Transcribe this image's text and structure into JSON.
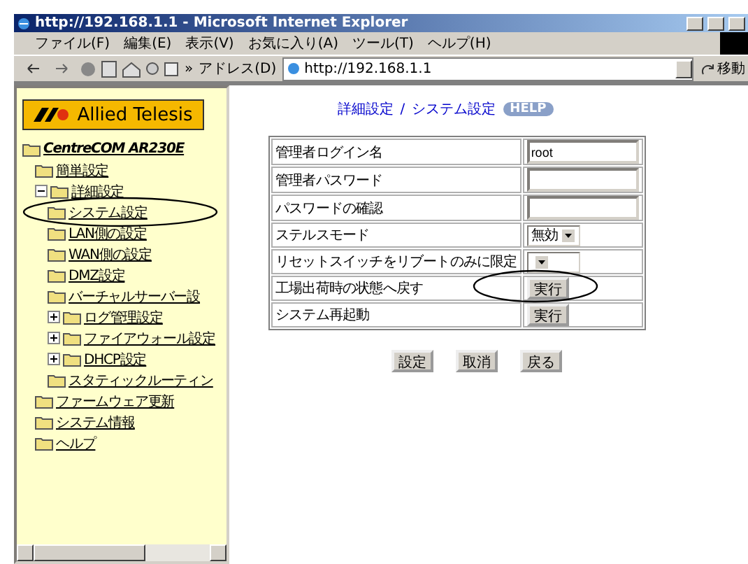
{
  "window": {
    "title": "http://192.168.1.1 - Microsoft Internet Explorer"
  },
  "menu": [
    "ファイル(F)",
    "編集(E)",
    "表示(V)",
    "お気に入り(A)",
    "ツール(T)",
    "ヘルプ(H)"
  ],
  "toolbar": {
    "chevron": "»",
    "address_label": "アドレス(D)",
    "address": "http://192.168.1.1",
    "go": "移動"
  },
  "sidebar": {
    "logo": "Allied Telesis",
    "tree": [
      {
        "label": "CentreCOM AR230E",
        "children": [
          {
            "label": "簡単設定"
          },
          {
            "label": "詳細設定",
            "expanded": true,
            "children": [
              {
                "label": "システム設定"
              },
              {
                "label": "LAN側の設定"
              },
              {
                "label": "WAN側の設定"
              },
              {
                "label": "DMZ設定"
              },
              {
                "label": "バーチャルサーバー設"
              },
              {
                "label": "ログ管理設定",
                "expanded": false
              },
              {
                "label": "ファイアウォール設定",
                "expanded": false
              },
              {
                "label": "DHCP設定",
                "expanded": false
              },
              {
                "label": "スタティックルーティン"
              }
            ]
          },
          {
            "label": "ファームウェア更新"
          },
          {
            "label": "システム情報"
          },
          {
            "label": "ヘルプ"
          }
        ]
      }
    ]
  },
  "content": {
    "breadcrumb": [
      "詳細設定",
      "システム設定"
    ],
    "separator": "/",
    "help": "HELP",
    "rows": [
      {
        "label": "管理者ログイン名",
        "kind": "text",
        "value": "root"
      },
      {
        "label": "管理者パスワード",
        "kind": "password"
      },
      {
        "label": "パスワードの確認",
        "kind": "password"
      },
      {
        "label": "ステルスモード",
        "kind": "select",
        "value": "無効"
      },
      {
        "label": "リセットスイッチをリブートのみに限定",
        "kind": "select"
      },
      {
        "label": "工場出荷時の状態へ戻す",
        "kind": "button",
        "value": "実行"
      },
      {
        "label": "システム再起動",
        "kind": "button",
        "value": "実行"
      }
    ],
    "buttons": [
      "設定",
      "取消",
      "戻る"
    ]
  }
}
